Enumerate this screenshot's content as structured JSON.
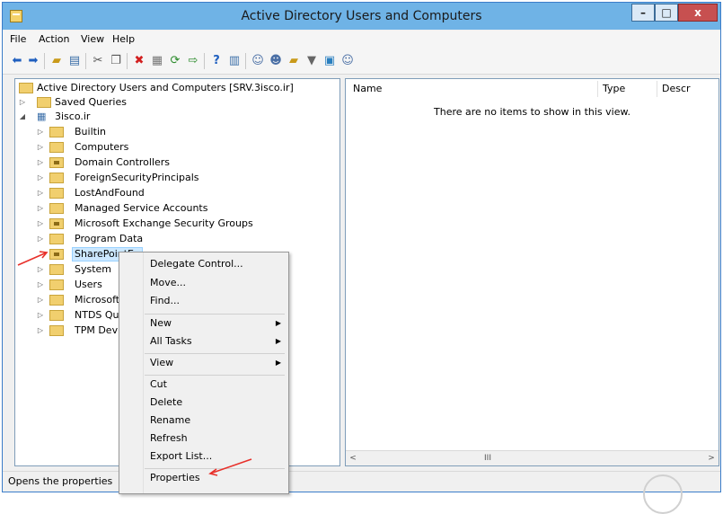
{
  "window": {
    "title": "Active Directory Users and Computers"
  },
  "menubar": {
    "items": [
      "File",
      "Action",
      "View",
      "Help"
    ]
  },
  "toolbar": {
    "icons": [
      "back-icon",
      "forward-icon",
      "up-folder-icon",
      "show-console-tree-icon",
      "cut-icon",
      "copy-icon",
      "delete-icon",
      "properties-icon",
      "refresh-icon",
      "export-list-icon",
      "help-icon",
      "show-action-pane-icon",
      "create-user-icon",
      "create-group-icon",
      "create-ou-icon",
      "filter-icon",
      "add-to-group-icon",
      "find-icon"
    ]
  },
  "tree": {
    "root": "Active Directory Users and Computers [SRV.3isco.ir]",
    "saved_queries": "Saved Queries",
    "domain": "3isco.ir",
    "items": [
      "Builtin",
      "Computers",
      "Domain Controllers",
      "ForeignSecurityPrincipals",
      "LostAndFound",
      "Managed Service Accounts",
      "Microsoft Exchange Security Groups",
      "Program Data",
      "SharePointEx",
      "System",
      "Users",
      "Microsoft",
      "NTDS Qu",
      "TPM Devi"
    ],
    "selected": "SharePointEx"
  },
  "list": {
    "columns": [
      "Name",
      "Type",
      "Descr"
    ],
    "empty_message": "There are no items to show in this view."
  },
  "context_menu": {
    "group1": [
      "Delegate Control...",
      "Move...",
      "Find..."
    ],
    "group2": [
      "New",
      "All Tasks"
    ],
    "group3": [
      "View"
    ],
    "group4": [
      "Cut",
      "Delete",
      "Rename",
      "Refresh",
      "Export List..."
    ],
    "group5": [
      "Properties"
    ]
  },
  "scrollbar": {
    "thumb_glyph": "III",
    "left_glyph": "<",
    "right_glyph": ">"
  },
  "status": {
    "text": "Opens the properties"
  },
  "colors": {
    "titlebar": "#6fb3e6",
    "close": "#c75050",
    "annotation_arrow": "#e8302a",
    "selection": "#cce8ff"
  }
}
